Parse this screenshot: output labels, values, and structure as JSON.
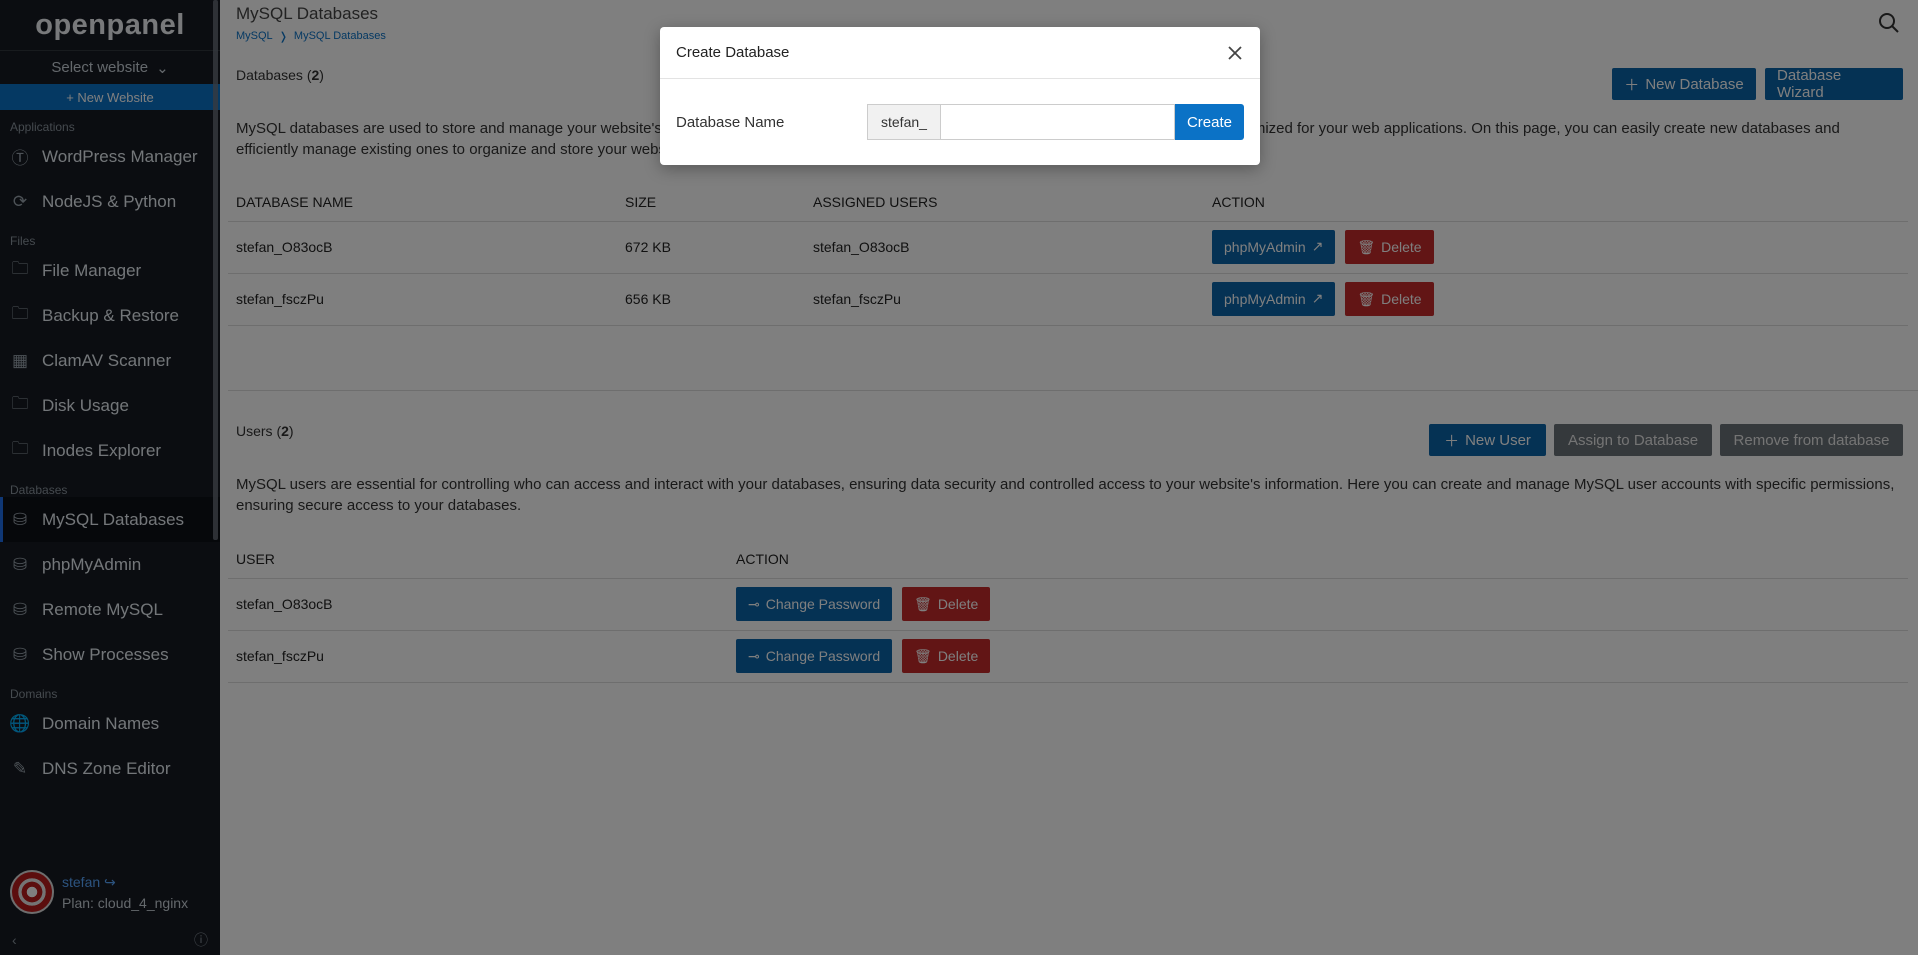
{
  "sidebar": {
    "brand": "openpanel",
    "select_website": "Select website",
    "new_website": "+ New Website",
    "sections": [
      {
        "label": "Applications",
        "items": [
          {
            "label": "WordPress Manager",
            "icon": "wordpress-icon"
          },
          {
            "label": "NodeJS & Python",
            "icon": "node-icon"
          }
        ]
      },
      {
        "label": "Files",
        "items": [
          {
            "label": "File Manager",
            "icon": "folder-icon"
          },
          {
            "label": "Backup & Restore",
            "icon": "folder-icon"
          },
          {
            "label": "ClamAV Scanner",
            "icon": "scanner-icon"
          },
          {
            "label": "Disk Usage",
            "icon": "folder-icon"
          },
          {
            "label": "Inodes Explorer",
            "icon": "folder-icon"
          }
        ]
      },
      {
        "label": "Databases",
        "items": [
          {
            "label": "MySQL Databases",
            "icon": "database-icon",
            "active": true
          },
          {
            "label": "phpMyAdmin",
            "icon": "database-icon"
          },
          {
            "label": "Remote MySQL",
            "icon": "database-icon"
          },
          {
            "label": "Show Processes",
            "icon": "database-icon"
          }
        ]
      },
      {
        "label": "Domains",
        "items": [
          {
            "label": "Domain Names",
            "icon": "globe-icon"
          },
          {
            "label": "DNS Zone Editor",
            "icon": "edit-icon"
          }
        ]
      }
    ],
    "user": {
      "name": "stefan",
      "plan": "Plan: cloud_4_nginx"
    }
  },
  "header": {
    "title": "MySQL Databases",
    "breadcrumb": [
      "MySQL",
      "MySQL Databases"
    ]
  },
  "databases": {
    "title": "Databases",
    "count": "2",
    "new_button": "New Database",
    "wizard_button": "Database Wizard",
    "description": "MySQL databases are used to store and manage your website's data in a structured and organized manner, ensuring data is efficiently managed and optimized for your web applications. On this page, you can easily create new databases and efficiently manage existing ones to organize and store your website's data.",
    "columns": [
      "DATABASE NAME",
      "SIZE",
      "ASSIGNED USERS",
      "ACTION"
    ],
    "rows": [
      {
        "name": "stefan_O83ocB",
        "size": "672 KB",
        "users": "stefan_O83ocB"
      },
      {
        "name": "stefan_fsczPu",
        "size": "656 KB",
        "users": "stefan_fsczPu"
      }
    ],
    "phpmyadmin_label": "phpMyAdmin",
    "delete_label": "Delete"
  },
  "users": {
    "title": "Users",
    "count": "2",
    "new_button": "New  User",
    "assign_button": "Assign  to Database",
    "remove_button": "Remove  from database",
    "description": "MySQL users are essential for controlling who can access and interact with your databases, ensuring data security and controlled access to your website's information. Here you can create and manage MySQL user accounts with specific permissions, ensuring secure access to your databases.",
    "columns": [
      "USER",
      "ACTION"
    ],
    "rows": [
      {
        "name": "stefan_O83ocB"
      },
      {
        "name": "stefan_fsczPu"
      }
    ],
    "change_password_label": "Change Password",
    "delete_label": "Delete"
  },
  "modal": {
    "title": "Create Database",
    "field_label": "Database Name",
    "prefix": "stefan_",
    "input_value": "",
    "create_button": "Create"
  }
}
